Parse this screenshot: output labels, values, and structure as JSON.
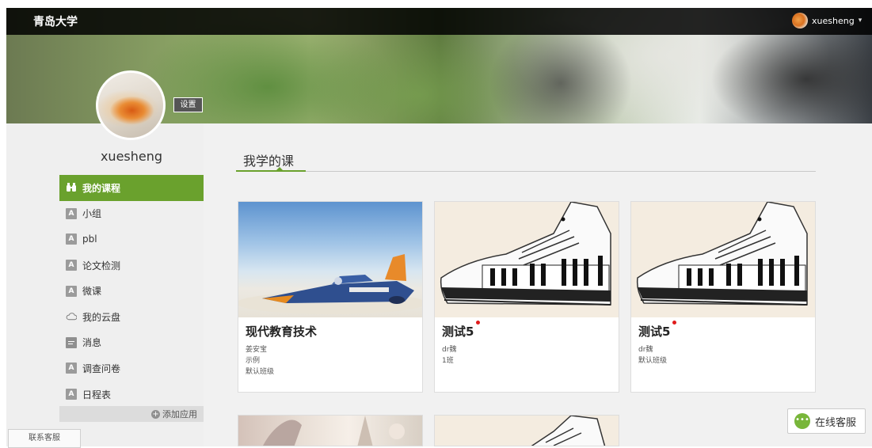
{
  "header": {
    "brand": "青岛大学",
    "user_name": "xuesheng"
  },
  "profile": {
    "name": "xuesheng",
    "settings_label": "设置"
  },
  "sidebar": {
    "items": [
      {
        "label": "我的课程",
        "icon": "binoculars-icon",
        "active": true
      },
      {
        "label": "小组",
        "icon": "app-icon"
      },
      {
        "label": "pbl",
        "icon": "app-icon"
      },
      {
        "label": "论文检测",
        "icon": "app-icon"
      },
      {
        "label": "微课",
        "icon": "app-icon"
      },
      {
        "label": "我的云盘",
        "icon": "cloud-icon"
      },
      {
        "label": "消息",
        "icon": "message-icon"
      },
      {
        "label": "调查问卷",
        "icon": "app-icon"
      },
      {
        "label": "日程表",
        "icon": "app-icon"
      }
    ],
    "app_icon_letter": "A",
    "add_app_label": "添加应用",
    "contact_label": "联系客服"
  },
  "main": {
    "section_title": "我学的课",
    "courses": [
      {
        "title": "现代教育技术",
        "teacher": "姜安宝",
        "line2": "示例",
        "line3": "默认班级",
        "new": false,
        "thumb": "rocket-car"
      },
      {
        "title": "测试5",
        "teacher": "dr魏",
        "line2": "1班",
        "new": true,
        "thumb": "piano-sneaker"
      },
      {
        "title": "测试5",
        "teacher": "dr魏",
        "line2": "默认班级",
        "new": true,
        "thumb": "piano-sneaker"
      }
    ]
  },
  "online_service": {
    "label": "在线客服"
  },
  "colors": {
    "accent": "#6aa12d",
    "new_dot": "#e01b1b",
    "topbar": "#111111"
  }
}
